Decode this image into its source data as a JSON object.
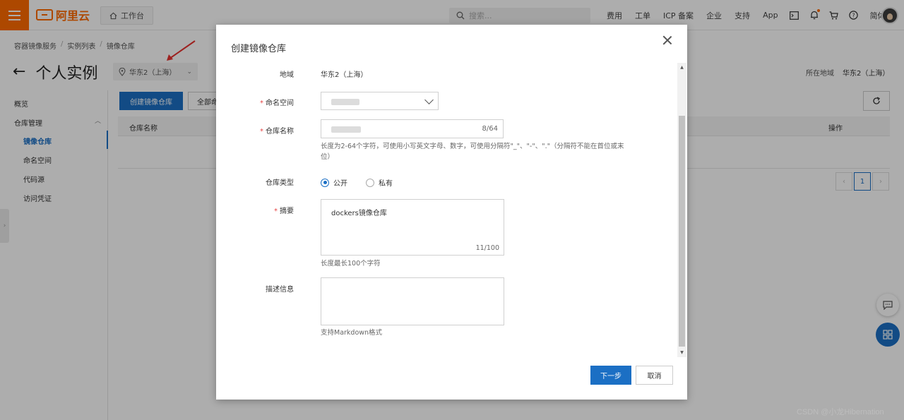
{
  "topbar": {
    "logo_text": "阿里云",
    "workbench": "工作台",
    "search_placeholder": "搜索...",
    "nav": [
      "费用",
      "工单",
      "ICP 备案",
      "企业",
      "支持",
      "App"
    ],
    "language": "简体"
  },
  "breadcrumb": [
    "容器镜像服务",
    "实例列表",
    "镜像仓库"
  ],
  "page": {
    "title": "个人实例",
    "region_select": "华东2（上海）",
    "region_label": "所在地域",
    "region_value": "华东2（上海）"
  },
  "sidebar": {
    "items": [
      {
        "label": "概览"
      },
      {
        "label": "仓库管理"
      },
      {
        "label": "镜像仓库"
      },
      {
        "label": "命名空间"
      },
      {
        "label": "代码源"
      },
      {
        "label": "访问凭证"
      }
    ]
  },
  "toolbar": {
    "create_label": "创建镜像仓库",
    "all_label": "全部命"
  },
  "table": {
    "columns": [
      "仓库名称",
      "操作"
    ]
  },
  "pagination": {
    "current": "1"
  },
  "modal": {
    "title": "创建镜像仓库",
    "region": {
      "label": "地域",
      "value": "华东2（上海）"
    },
    "namespace": {
      "label": "命名空间"
    },
    "repo_name": {
      "label": "仓库名称",
      "counter": "8/64",
      "hint": "长度为2-64个字符，可使用小写英文字母、数字，可使用分隔符\"_\"、\"-\"、\".\"（分隔符不能在首位或末位）"
    },
    "repo_type": {
      "label": "仓库类型",
      "options": [
        "公开",
        "私有"
      ],
      "selected": "公开"
    },
    "summary": {
      "label": "摘要",
      "value": "dockers镜像仓库",
      "counter": "11/100",
      "hint": "长度最长100个字符"
    },
    "description": {
      "label": "描述信息",
      "hint": "支持Markdown格式"
    },
    "next_label": "下一步",
    "cancel_label": "取消"
  },
  "watermark": "CSDN @小龙Hibernation",
  "colors": {
    "brand": "#ff6a00",
    "primary": "#1b6fc4",
    "required": "#e64545"
  }
}
